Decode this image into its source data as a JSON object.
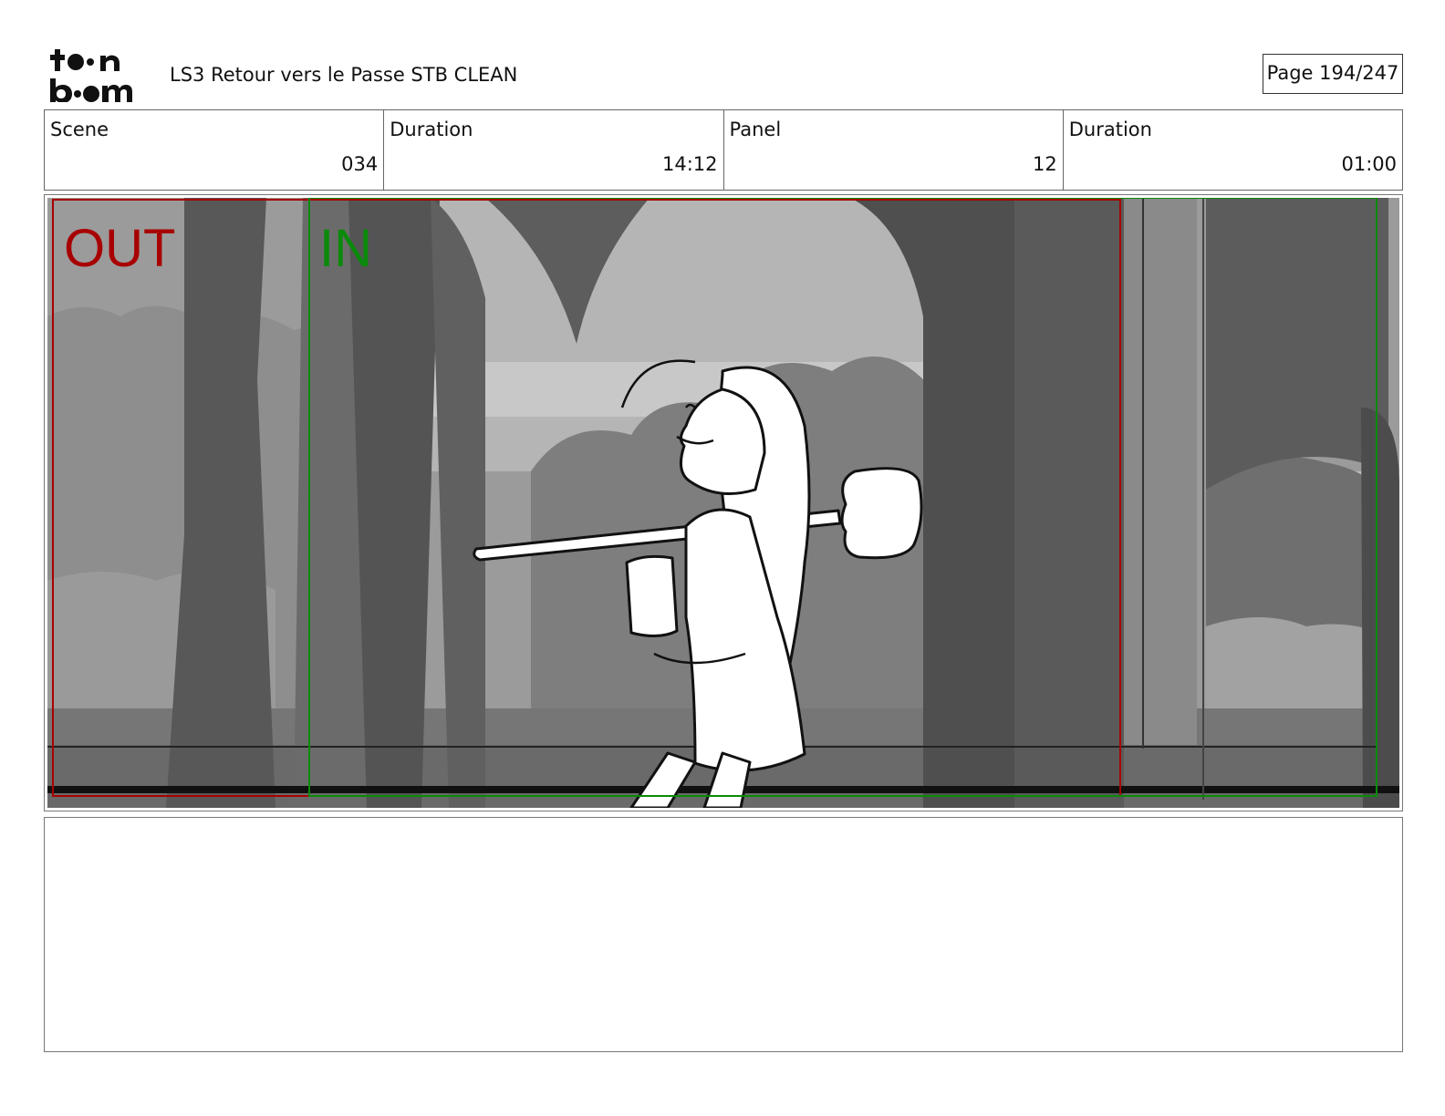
{
  "header": {
    "logo_text": "toon boom",
    "title": "LS3 Retour vers le Passe STB CLEAN",
    "page_label": "Page 194/247"
  },
  "info": {
    "scene_label": "Scene",
    "scene_value": "034",
    "scene_duration_label": "Duration",
    "scene_duration_value": "14:12",
    "panel_label": "Panel",
    "panel_value": "12",
    "panel_duration_label": "Duration",
    "panel_duration_value": "01:00"
  },
  "panel": {
    "out_marker": "OUT",
    "in_marker": "IN",
    "out_color": "#a80000",
    "in_color": "#0a8a0a"
  },
  "caption": {
    "text": ""
  }
}
